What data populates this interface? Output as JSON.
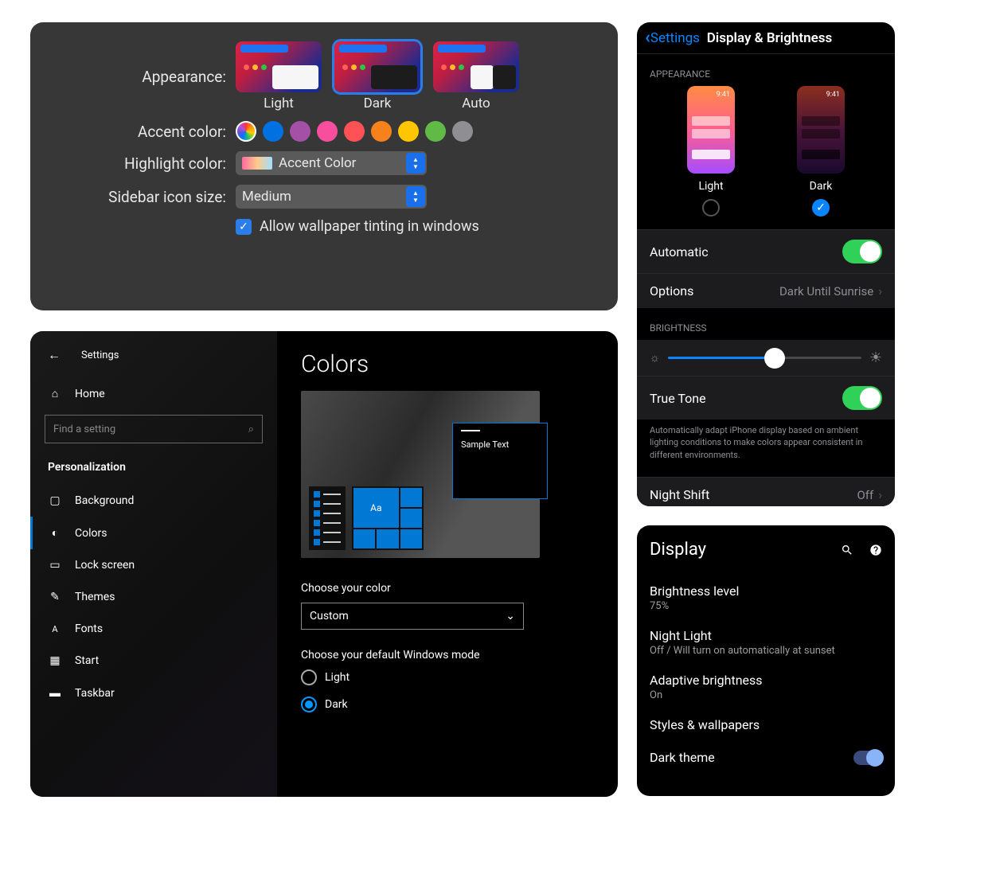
{
  "mac": {
    "labels": {
      "appearance": "Appearance:",
      "accent": "Accent color:",
      "highlight": "Highlight color:",
      "sidebar": "Sidebar icon size:"
    },
    "appearance_options": {
      "light": "Light",
      "dark": "Dark",
      "auto": "Auto"
    },
    "appearance_selected": "Dark",
    "accent_colors": [
      "multicolor",
      "#0071e3",
      "#a550a7",
      "#f74f9e",
      "#ff5257",
      "#f7821b",
      "#ffc600",
      "#62ba46",
      "#8e8e93"
    ],
    "highlight_value": "Accent Color",
    "sidebar_value": "Medium",
    "wallpaper_checkbox": "Allow wallpaper tinting in windows",
    "wallpaper_checked": true
  },
  "win": {
    "back_label": "Settings",
    "search_placeholder": "Find a setting",
    "section_heading": "Personalization",
    "nav": {
      "home": "Home",
      "background": "Background",
      "colors": "Colors",
      "lock": "Lock screen",
      "themes": "Themes",
      "fonts": "Fonts",
      "start": "Start",
      "taskbar": "Taskbar"
    },
    "nav_selected": "Colors",
    "main_title": "Colors",
    "sample_text": "Sample Text",
    "tile_aa": "Aa",
    "choose_color_label": "Choose your color",
    "choose_color_value": "Custom",
    "mode_label": "Choose your default Windows mode",
    "mode_light": "Light",
    "mode_dark": "Dark",
    "mode_selected": "Dark"
  },
  "ios": {
    "back": "Settings",
    "title": "Display & Brightness",
    "appearance_section": "APPEARANCE",
    "time": "9:41",
    "light_label": "Light",
    "dark_label": "Dark",
    "appearance_selected": "Dark",
    "automatic_label": "Automatic",
    "automatic_on": true,
    "options_label": "Options",
    "options_value": "Dark Until Sunrise",
    "brightness_section": "BRIGHTNESS",
    "truetone_label": "True Tone",
    "truetone_on": true,
    "truetone_desc": "Automatically adapt iPhone display based on ambient lighting conditions to make colors appear consistent in different environments.",
    "nightshift_label": "Night Shift",
    "nightshift_value": "Off"
  },
  "android": {
    "title": "Display",
    "brightness_label": "Brightness level",
    "brightness_value": "75%",
    "nightlight_label": "Night Light",
    "nightlight_value": "Off / Will turn on automatically at sunset",
    "adaptive_label": "Adaptive brightness",
    "adaptive_value": "On",
    "styles_label": "Styles & wallpapers",
    "darktheme_label": "Dark theme",
    "darktheme_on": true
  }
}
